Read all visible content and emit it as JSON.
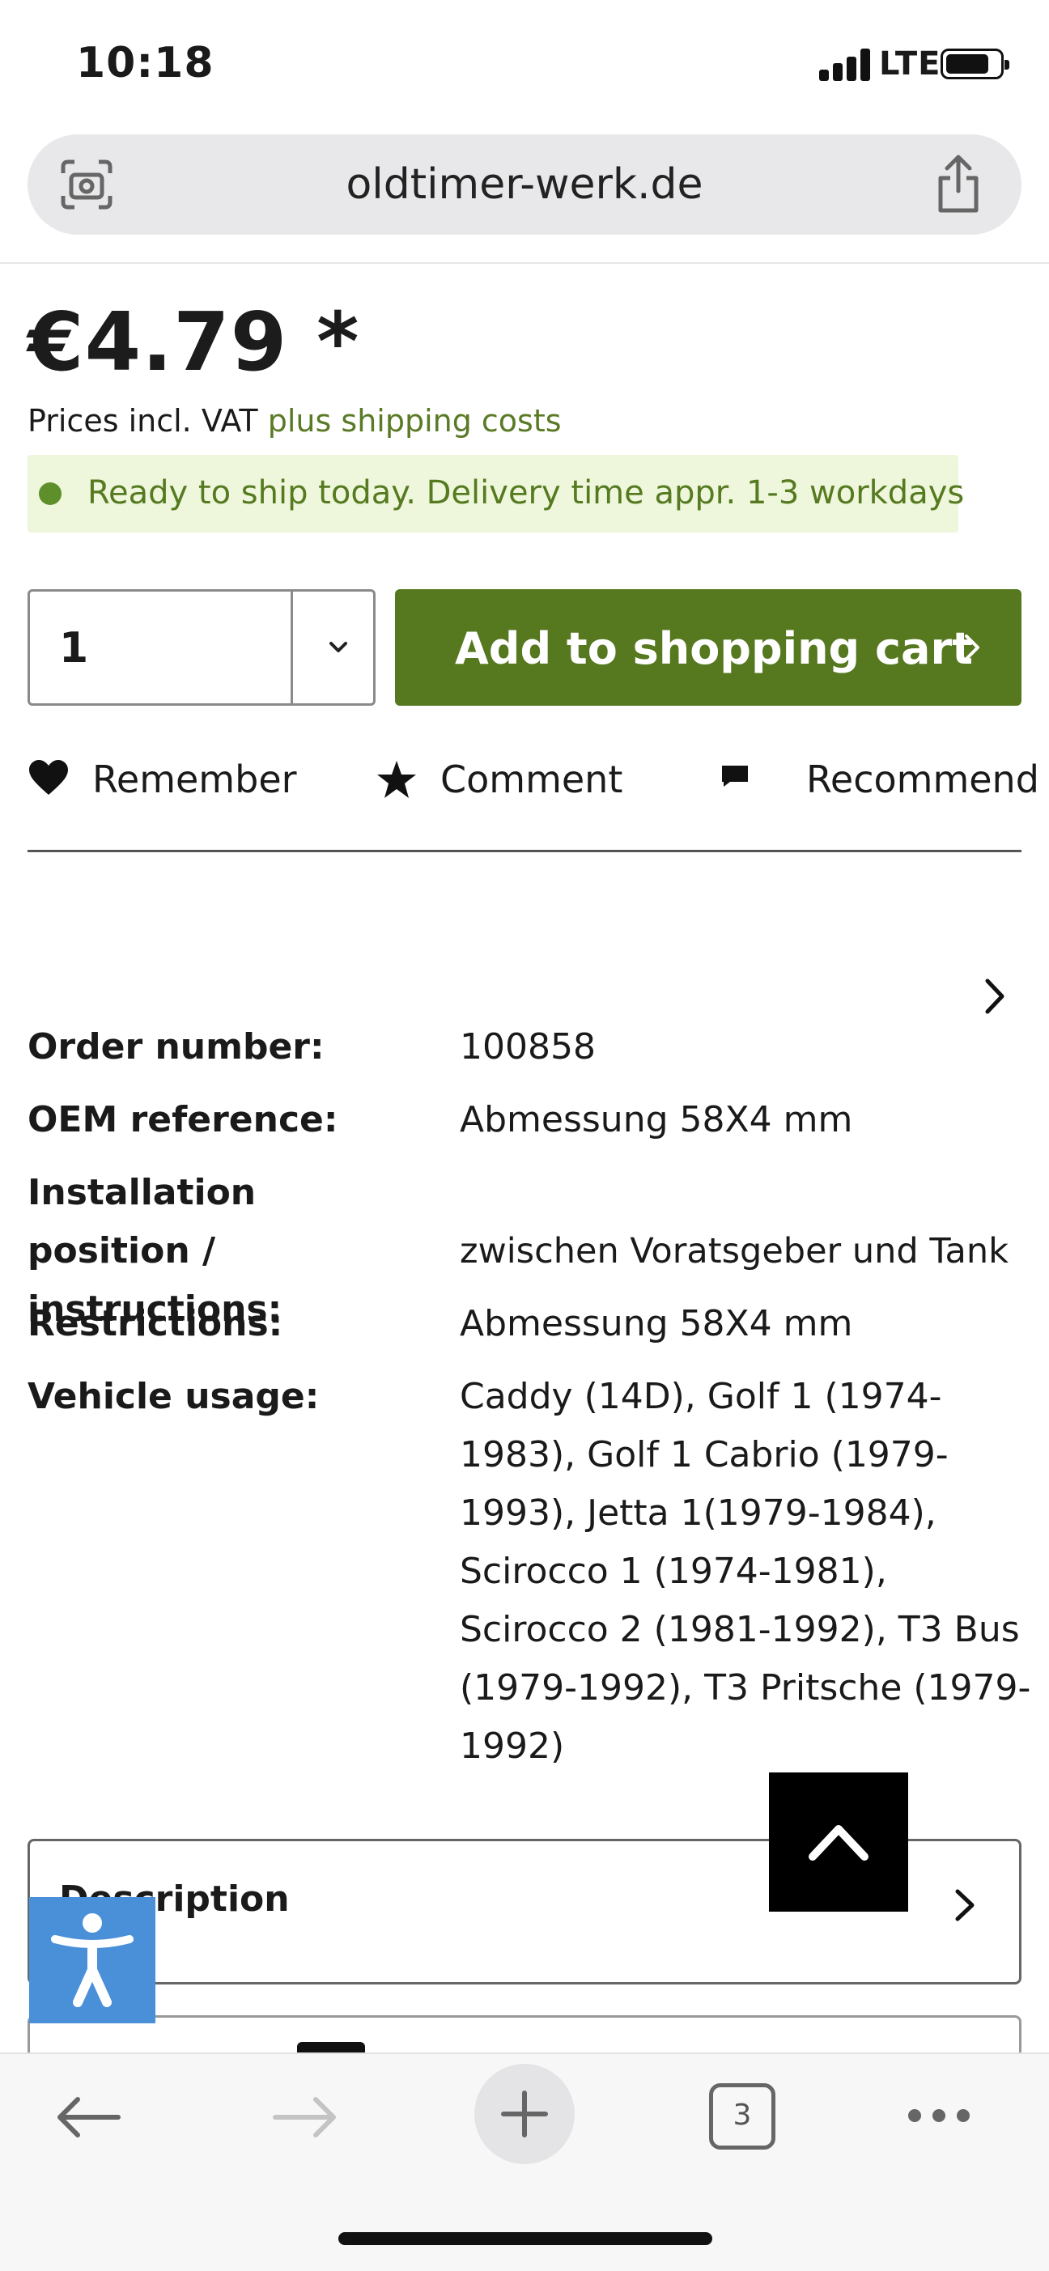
{
  "status_bar": {
    "time": "10:18",
    "network": "LTE"
  },
  "browser": {
    "url": "oldtimer-werk.de",
    "tab_count": "3"
  },
  "product": {
    "price": "€4.79 *",
    "vat_prefix": "Prices incl. VAT",
    "shipping_link": "plus shipping costs",
    "delivery_text": "Ready to ship today. Delivery time appr. 1-3 workdays",
    "quantity": "1",
    "add_to_cart": "Add to shopping cart"
  },
  "actions": {
    "remember": "Remember",
    "comment": "Comment",
    "recommend": "Recommend"
  },
  "details": [
    {
      "key": "Order number:",
      "value": "100858"
    },
    {
      "key": "OEM reference:",
      "value": "Abmessung 58X4 mm"
    },
    {
      "key": "Installation position / instructions:",
      "value": "zwischen Voratsgeber und Tank"
    },
    {
      "key": "Restrictions:",
      "value": "Abmessung 58X4 mm"
    },
    {
      "key": "Vehicle usage:",
      "value": "Caddy (14D), Golf 1 (1974-1983), Golf 1 Cabrio (1979-1993), Jetta 1(1979-1984), Scirocco 1 (1974-1981), Scirocco 2 (1981-1992), T3 Bus (1979-1992), T3 Pritsche (1979-1992)"
    }
  ],
  "sections": {
    "description": "Description"
  },
  "colors": {
    "brand_green": "#56781f",
    "delivery_bg": "#eef6dc",
    "accessibility_blue": "#4a90d9"
  }
}
